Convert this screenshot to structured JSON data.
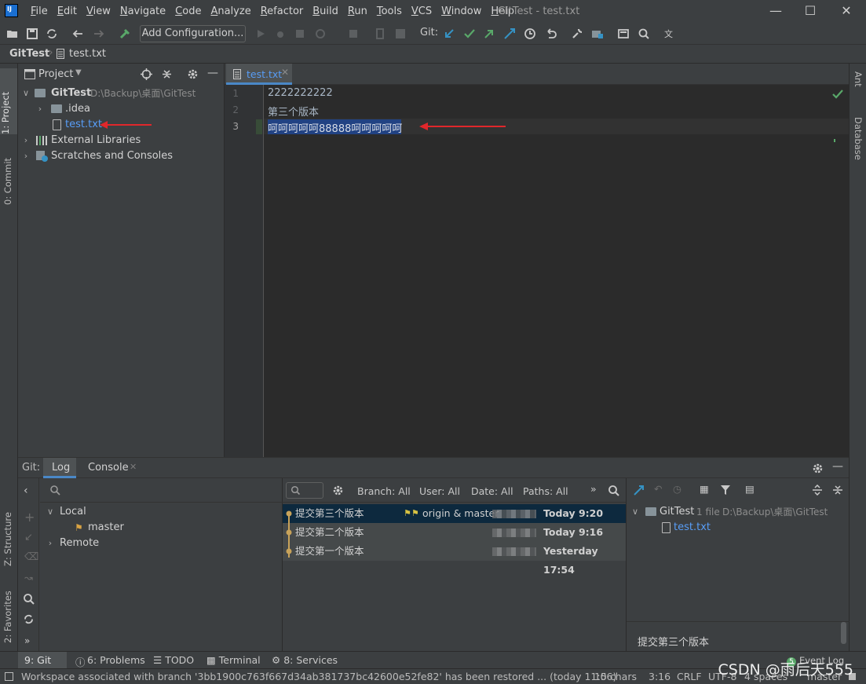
{
  "menubar": {
    "items": [
      "File",
      "Edit",
      "View",
      "Navigate",
      "Code",
      "Analyze",
      "Refactor",
      "Build",
      "Run",
      "Tools",
      "VCS",
      "Window",
      "Help"
    ],
    "title": "GitTest - test.txt"
  },
  "toolbar": {
    "add_configuration": "Add Configuration...",
    "git_label": "Git:"
  },
  "navbar": {
    "project": "GitTest",
    "file": "test.txt"
  },
  "left_stripe": {
    "project": "1: Project",
    "commit": "0: Commit",
    "structure": "Z: Structure",
    "favorites": "2: Favorites"
  },
  "right_stripe": {
    "ant": "Ant",
    "database": "Database"
  },
  "project_panel": {
    "title": "Project",
    "tree": {
      "root": "GitTest",
      "root_path": "D:\\Backup\\桌面\\GitTest",
      "idea": ".idea",
      "file": "test.txt",
      "external": "External Libraries",
      "scratches": "Scratches and Consoles"
    }
  },
  "editor": {
    "tab": "test.txt",
    "lines": [
      {
        "num": "1",
        "text": "2222222222"
      },
      {
        "num": "2",
        "text": "第三个版本"
      },
      {
        "num": "3",
        "text": "呵呵呵呵呵88888呵呵呵呵呵"
      }
    ]
  },
  "git_panel": {
    "title": "Git:",
    "tabs": [
      "Log",
      "Console"
    ],
    "branches": {
      "local": "Local",
      "master": "master",
      "remote": "Remote"
    },
    "filters": {
      "branch": "Branch: All",
      "user": "User: All",
      "date": "Date: All",
      "paths": "Paths: All"
    },
    "commits": [
      {
        "message": "提交第三个版本",
        "refs": "origin & master",
        "date": "Today 9:20"
      },
      {
        "message": "提交第二个版本",
        "refs": "",
        "date": "Today 9:16"
      },
      {
        "message": "提交第一个版本",
        "refs": "",
        "date": "Yesterday 17:54"
      }
    ],
    "details": {
      "repo": "GitTest",
      "file_count": "1 file",
      "repo_path": "D:\\Backup\\桌面\\GitTest",
      "file": "test.txt",
      "commit_message": "提交第三个版本"
    }
  },
  "toolwindow_bar": {
    "git": "9: Git",
    "problems": "6: Problems",
    "todo": "TODO",
    "terminal": "Terminal",
    "services": "8: Services",
    "event_log": "Event Log",
    "event_count": "5"
  },
  "status_bar": {
    "message": "Workspace associated with branch '3bb1900c763f667d34ab381737bc42600e52fe82' has been restored ... (today 11:06)",
    "chars": "15 chars",
    "position": "3:16",
    "line_sep": "CRLF",
    "encoding": "UTF-8",
    "indent": "4 spaces",
    "branch": "master"
  },
  "watermark": "CSDN @雨后天555",
  "colors": {
    "accent": "#4a88c7",
    "selection": "#214283",
    "annotation_arrow": "#e0272b"
  }
}
